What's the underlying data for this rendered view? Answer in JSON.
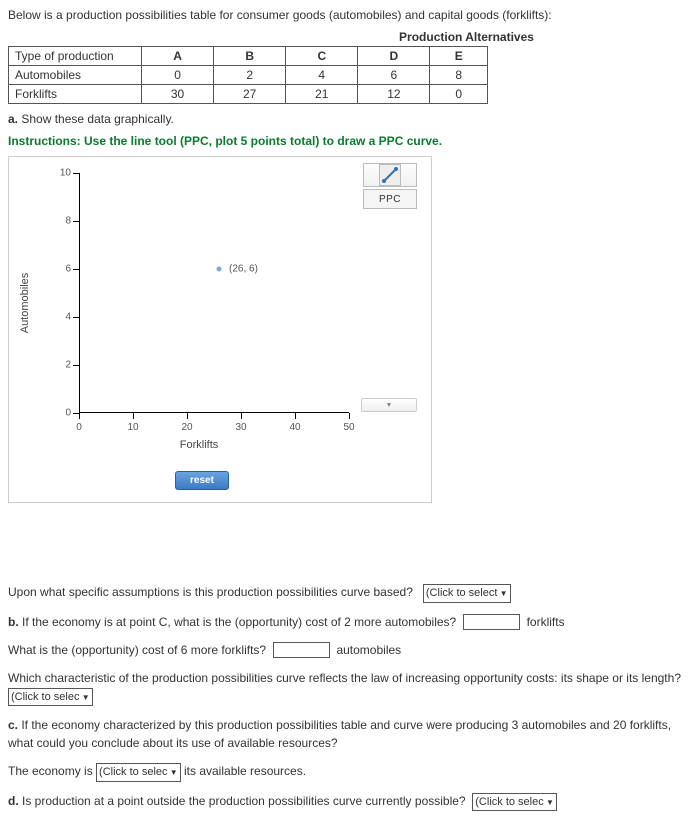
{
  "intro": "Below is a production possibilities table for consumer goods (automobiles) and capital goods (forklifts):",
  "table_title": "Production Alternatives",
  "table": {
    "row_header_label": "Type of production",
    "columns": [
      "A",
      "B",
      "C",
      "D",
      "E"
    ],
    "rows": [
      {
        "label": "Automobiles",
        "values": [
          "0",
          "2",
          "4",
          "6",
          "8"
        ]
      },
      {
        "label": "Forklifts",
        "values": [
          "30",
          "27",
          "21",
          "12",
          "0"
        ]
      }
    ]
  },
  "q_a_prefix": "a.",
  "q_a_text": " Show these data graphically.",
  "instructions": "Instructions: Use the line tool (PPC, plot 5 points total) to draw a PPC curve.",
  "legend_label": "PPC",
  "chart_y_label": "Automobiles",
  "chart_x_label": "Forklifts",
  "point_label": "(26, 6)",
  "reset_label": "reset",
  "chart_data": {
    "type": "scatter",
    "title": "",
    "xlabel": "Forklifts",
    "ylabel": "Automobiles",
    "xlim": [
      0,
      50
    ],
    "ylim": [
      0,
      10
    ],
    "x_ticks": [
      0,
      10,
      20,
      30,
      40,
      50
    ],
    "y_ticks": [
      0,
      2,
      4,
      6,
      8,
      10
    ],
    "series": [
      {
        "name": "PPC",
        "x": [
          26
        ],
        "y": [
          6
        ]
      }
    ],
    "annotations": [
      {
        "x": 26,
        "y": 6,
        "text": "(26, 6)"
      }
    ]
  },
  "assumptions_q": "Upon what specific assumptions is this production possibilities curve based?",
  "select_placeholder": "(Click to select",
  "select_placeholder2": "(Click to selec",
  "q_b_prefix": "b.",
  "q_b_text": " If the economy is at point C, what is the (opportunity) cost of 2 more automobiles?",
  "q_b_unit": "forklifts",
  "q_b2_text": "What is the (opportunity) cost of 6 more forklifts?",
  "q_b2_unit": "automobiles",
  "q_shape": "Which characteristic of the production possibilities curve reflects the law of increasing opportunity costs: its shape or its length?",
  "q_c_prefix": "c.",
  "q_c_text": " If the economy characterized by this production possibilities table and curve were producing 3 automobiles and 20 forklifts, what could you conclude about its use of available resources?",
  "q_c_answer_pre": "The economy is ",
  "q_c_answer_post": " its available resources.",
  "q_d_prefix": "d.",
  "q_d_text": " Is production at a point outside the production possibilities curve currently possible?"
}
